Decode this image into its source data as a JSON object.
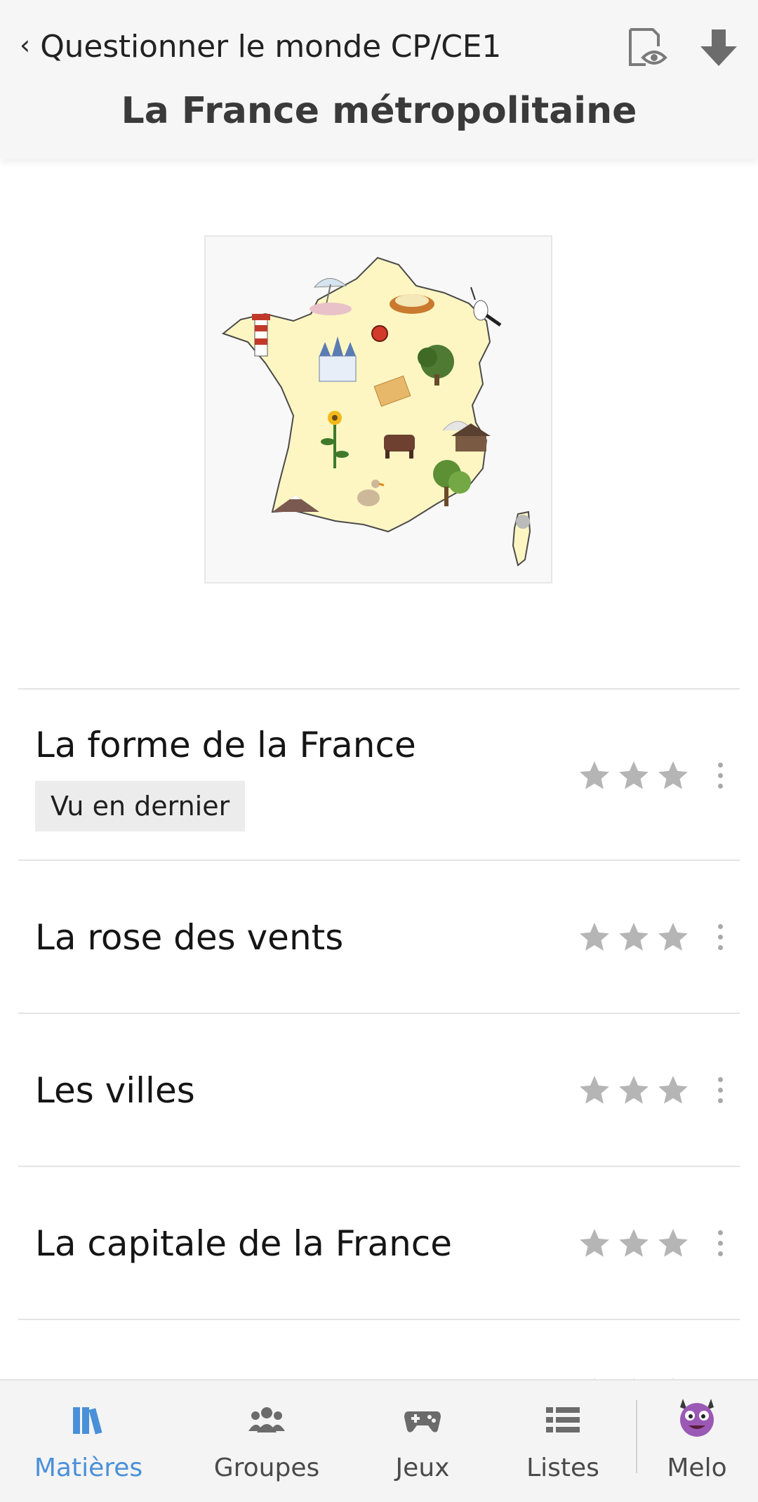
{
  "header": {
    "back_label": "Questionner le monde CP/CE1",
    "title": "La France métropolitaine",
    "icons": [
      "chevron-left-icon",
      "preview-eye-icon",
      "download-arrow-icon"
    ]
  },
  "lessons": [
    {
      "title": "La forme de la France",
      "tag": "Vu en dernier",
      "stars_earned": 0,
      "stars_total": 3
    },
    {
      "title": "La rose des vents",
      "stars_earned": 0,
      "stars_total": 3
    },
    {
      "title": "Les villes",
      "stars_earned": 0,
      "stars_total": 3
    },
    {
      "title": "La capitale de la France",
      "stars_earned": 0,
      "stars_total": 3
    }
  ],
  "tabs": [
    {
      "label": "Matières",
      "icon": "books-icon",
      "active": true
    },
    {
      "label": "Groupes",
      "icon": "group-icon",
      "active": false
    },
    {
      "label": "Jeux",
      "icon": "gamepad-icon",
      "active": false
    },
    {
      "label": "Listes",
      "icon": "list-icon",
      "active": false
    },
    {
      "label": "Melo",
      "icon": "monster-avatar-icon",
      "active": false
    }
  ],
  "colors": {
    "accent": "#4a90d9",
    "star_empty": "#b5b5b5",
    "header_bg": "#f6f6f6",
    "map_land": "#fdf6c3"
  }
}
